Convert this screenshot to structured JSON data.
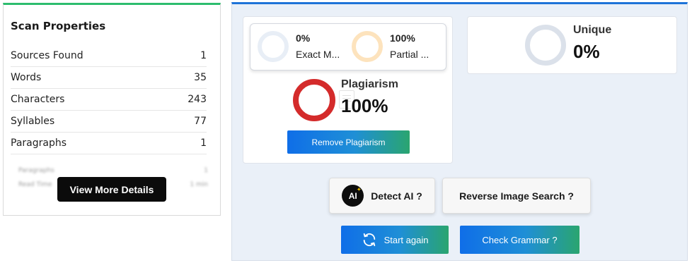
{
  "scan": {
    "title": "Scan Properties",
    "rows": [
      {
        "label": "Sources Found",
        "value": "1"
      },
      {
        "label": "Words",
        "value": "35"
      },
      {
        "label": "Characters",
        "value": "243"
      },
      {
        "label": "Syllables",
        "value": "77"
      },
      {
        "label": "Paragraphs",
        "value": "1"
      }
    ],
    "blurred_rows": [
      {
        "label": "Paragraphs",
        "value": "1"
      },
      {
        "label": "Read Time",
        "value": "1 min"
      }
    ],
    "more_button": "View More Details"
  },
  "results": {
    "exact": {
      "percent": "0%",
      "label": "Exact M..."
    },
    "partial": {
      "percent": "100%",
      "label": "Partial ..."
    },
    "plagiarism": {
      "label": "Plagiarism",
      "value": "100%"
    },
    "unique": {
      "label": "Unique",
      "value": "0%"
    },
    "remove_button": "Remove Plagiarism",
    "detect_ai_button": "Detect AI ?",
    "reverse_image_button": "Reverse Image Search ?",
    "start_again_button": "Start again",
    "check_grammar_button": "Check Grammar ?"
  },
  "icons": {
    "ai": "AI",
    "refresh": "refresh-icon"
  },
  "colors": {
    "accent_green": "#2dbd6e",
    "accent_blue": "#1e73d8",
    "plagiarism_red": "#d42b2b",
    "exact_ring": "#e8eef6",
    "partial_ring": "#fde3bd",
    "unique_ring": "#dbe1ea"
  }
}
